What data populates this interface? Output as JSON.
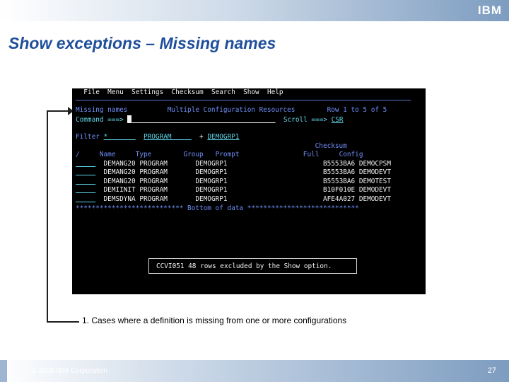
{
  "header": {
    "logo_text": "IBM"
  },
  "slide": {
    "title": "Show exceptions – Missing names",
    "caption": "1.  Cases where a definition is missing from one or more configurations"
  },
  "terminal": {
    "menu": {
      "file": "File",
      "menu": "Menu",
      "settings": "Settings",
      "checksum": "Checksum",
      "search": "Search",
      "show": "Show",
      "help": "Help"
    },
    "panel_name": "Missing names",
    "panel_title": "Multiple Configuration Resources",
    "row_info": "Row 1 to 5 of 5",
    "command_label": "Command ===>",
    "scroll_label": "Scroll ===>",
    "scroll_value": "CSR",
    "filter_label": "Filter",
    "filter_value": "*",
    "filter_type": "PROGRAM",
    "filter_op": "+",
    "filter_group": "DEMOGRP1",
    "col_checksum": "Checksum",
    "columns": {
      "sel": "/",
      "name": "Name",
      "type": "Type",
      "group": "Group",
      "prompt": "Prompt",
      "full": "Full",
      "config": "Config"
    },
    "rows": [
      {
        "name": "DEMANG20",
        "type": "PROGRAM",
        "group": "DEMOGRP1",
        "full": "B5553BA6",
        "config": "DEMOCPSM"
      },
      {
        "name": "DEMANG20",
        "type": "PROGRAM",
        "group": "DEMOGRP1",
        "full": "B5553BA6",
        "config": "DEMODEVT"
      },
      {
        "name": "DEMANG20",
        "type": "PROGRAM",
        "group": "DEMOGRP1",
        "full": "B5553BA6",
        "config": "DEMOTEST"
      },
      {
        "name": "DEMIINIT",
        "type": "PROGRAM",
        "group": "DEMOGRP1",
        "full": "B10F010E",
        "config": "DEMODEVT"
      },
      {
        "name": "DEMSDYNA",
        "type": "PROGRAM",
        "group": "DEMOGRP1",
        "full": "AFE4A027",
        "config": "DEMODEVT"
      }
    ],
    "bottom_marker": "Bottom of data",
    "message": "CCVI051 48 rows excluded by the Show option."
  },
  "footer": {
    "copyright": "© 2008 IBM Corporation",
    "page_number": "27"
  },
  "colors": {
    "title": "#1f4f9c",
    "terminal_bg": "#000000",
    "terminal_white": "#f2f2f2",
    "terminal_blue": "#6f8ff8",
    "terminal_turquoise": "#5fd6e8"
  }
}
